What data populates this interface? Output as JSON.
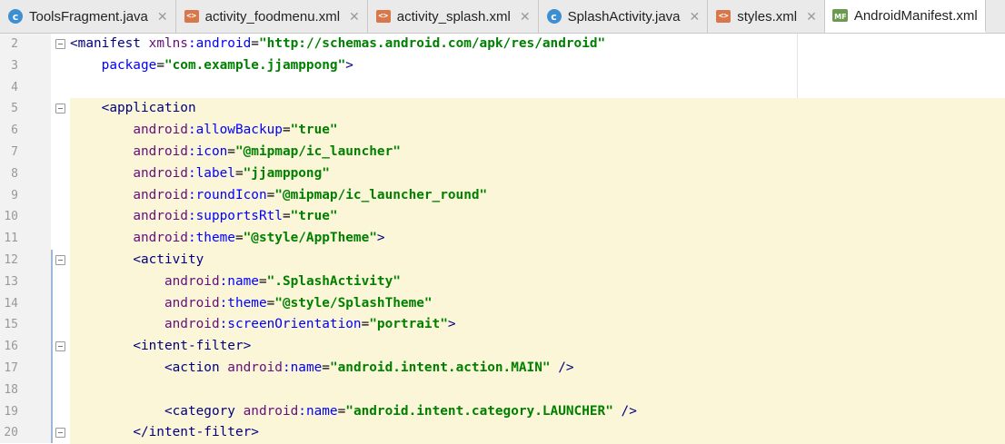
{
  "tabs": [
    {
      "label": "ToolsFragment.java",
      "icon": "java-class-icon",
      "active": false
    },
    {
      "label": "activity_foodmenu.xml",
      "icon": "xml-file-icon",
      "active": false
    },
    {
      "label": "activity_splash.xml",
      "icon": "xml-file-icon",
      "active": false
    },
    {
      "label": "SplashActivity.java",
      "icon": "java-class-icon",
      "active": false
    },
    {
      "label": "styles.xml",
      "icon": "xml-file-icon",
      "active": false
    },
    {
      "label": "AndroidManifest.xml",
      "icon": "manifest-file-icon",
      "active": true
    }
  ],
  "tab_close_glyph": "✕",
  "icon_glyphs": {
    "java": "c",
    "xml": "<>",
    "manifest": "MF"
  },
  "colors": {
    "highlight": "#fbf6d8",
    "tag": "#000080",
    "attr": "#0000ff",
    "namespace": "#660e7a",
    "value": "#008000"
  },
  "lines": [
    {
      "num": "2",
      "text": "<manifest xmlns:android=\"http://schemas.android.com/apk/res/android\""
    },
    {
      "num": "3",
      "text": "    package=\"com.example.jjamppong\">"
    },
    {
      "num": "4",
      "text": ""
    },
    {
      "num": "5",
      "text": "    <application"
    },
    {
      "num": "6",
      "text": "        android:allowBackup=\"true\""
    },
    {
      "num": "7",
      "text": "        android:icon=\"@mipmap/ic_launcher\""
    },
    {
      "num": "8",
      "text": "        android:label=\"jjamppong\""
    },
    {
      "num": "9",
      "text": "        android:roundIcon=\"@mipmap/ic_launcher_round\""
    },
    {
      "num": "10",
      "text": "        android:supportsRtl=\"true\""
    },
    {
      "num": "11",
      "text": "        android:theme=\"@style/AppTheme\">"
    },
    {
      "num": "12",
      "text": "        <activity"
    },
    {
      "num": "13",
      "text": "            android:name=\".SplashActivity\""
    },
    {
      "num": "14",
      "text": "            android:theme=\"@style/SplashTheme\""
    },
    {
      "num": "15",
      "text": "            android:screenOrientation=\"portrait\">"
    },
    {
      "num": "16",
      "text": "        <intent-filter>"
    },
    {
      "num": "17",
      "text": "            <action android:name=\"android.intent.action.MAIN\" />"
    },
    {
      "num": "18",
      "text": ""
    },
    {
      "num": "19",
      "text": "            <category android:name=\"android.intent.category.LAUNCHER\" />"
    },
    {
      "num": "20",
      "text": "        </intent-filter>"
    }
  ]
}
